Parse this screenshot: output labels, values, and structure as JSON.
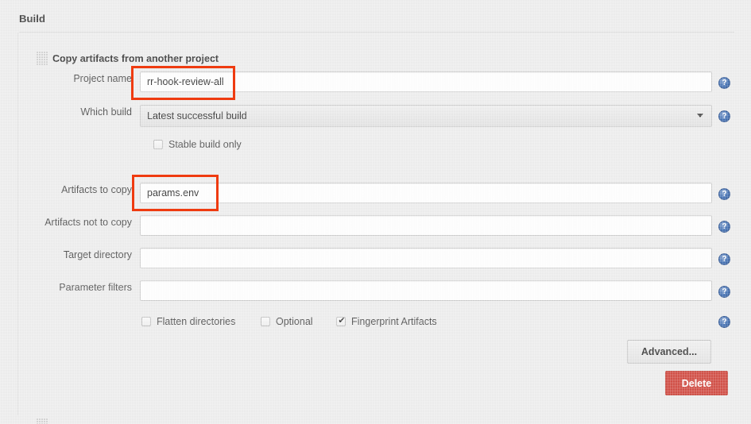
{
  "section": {
    "title": "Build"
  },
  "block": {
    "title": "Copy artifacts from another project",
    "grip_icon": "drag-grip-icon",
    "grip_icon_bottom": "drag-grip-icon"
  },
  "fields": {
    "project_name": {
      "label": "Project name",
      "value": "rr-hook-review-all",
      "placeholder": "",
      "help_icon": "help-question-icon"
    },
    "which_build": {
      "label": "Which build",
      "value": "Latest successful build",
      "options": [
        "Latest successful build"
      ],
      "caret_icon": "chevron-down-icon",
      "help_icon": "help-question-icon"
    },
    "stable_build_only": {
      "label": "Stable build only",
      "checked": false
    },
    "artifacts_to_copy": {
      "label": "Artifacts to copy",
      "value": "params.env",
      "placeholder": "",
      "help_icon": "help-question-icon"
    },
    "artifacts_not_to_copy": {
      "label": "Artifacts not to copy",
      "value": "",
      "placeholder": "",
      "help_icon": "help-question-icon"
    },
    "target_directory": {
      "label": "Target directory",
      "value": "",
      "placeholder": "",
      "help_icon": "help-question-icon"
    },
    "parameter_filters": {
      "label": "Parameter filters",
      "value": "",
      "placeholder": "",
      "help_icon": "help-question-icon"
    }
  },
  "options_row": {
    "flatten_directories": {
      "label": "Flatten directories",
      "checked": false
    },
    "optional": {
      "label": "Optional",
      "checked": false
    },
    "fingerprint_artifacts": {
      "label": "Fingerprint Artifacts",
      "checked": true
    },
    "help_icon": "help-question-icon"
  },
  "buttons": {
    "advanced": "Advanced...",
    "delete": "Delete"
  },
  "colors": {
    "page_background": "#ededed",
    "delete_button": "#d0453b",
    "help_icon": "#3c6bb0",
    "annotation_outline": "#ef3b10",
    "text": "#4b4b4b"
  },
  "annotations": [
    {
      "target": "project-name-input"
    },
    {
      "target": "artifacts-to-copy-input"
    }
  ]
}
